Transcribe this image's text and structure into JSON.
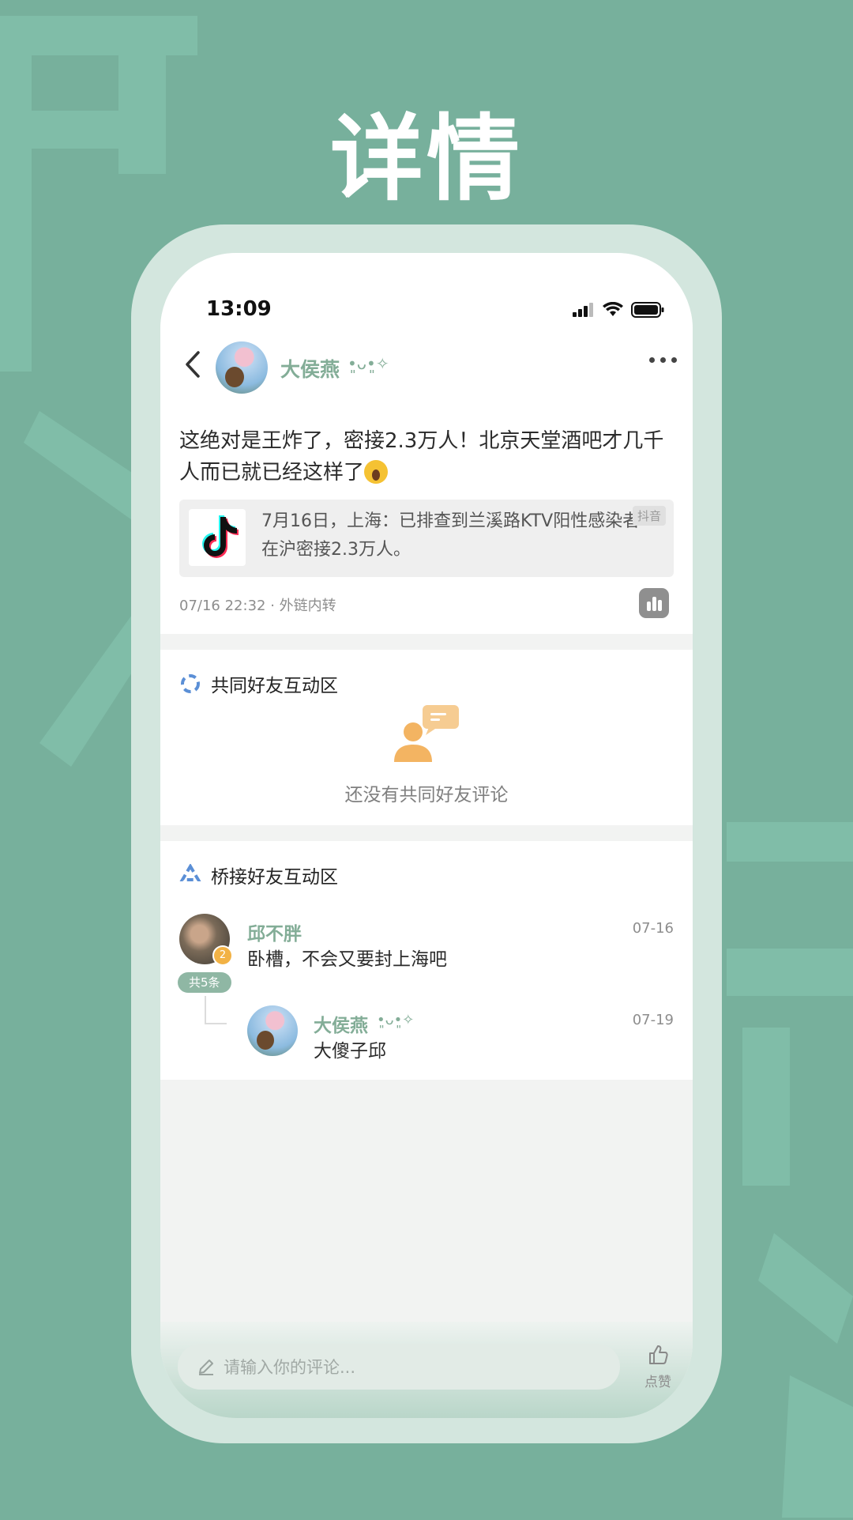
{
  "promo": {
    "title": "详情"
  },
  "status_bar": {
    "time": "13:09"
  },
  "header": {
    "user_name": "大侯燕",
    "name_deco": "•͈ᴗ•͈✧"
  },
  "post": {
    "text": "这绝对是王炸了，密接2.3万人！北京天堂酒吧才几千人而已就已经这样了",
    "emoji": "scream-emoji",
    "link_card": {
      "title": "7月16日，上海：已排查到兰溪路KTV阳性感染者在沪密接2.3万人。",
      "source_tag": "抖音",
      "icon": "tiktok-icon"
    },
    "meta": "07/16 22:32 · 外链内转"
  },
  "mutual_section": {
    "title": "共同好友互动区",
    "empty_text": "还没有共同好友评论"
  },
  "bridge_section": {
    "title": "桥接好友互动区",
    "comments": [
      {
        "name": "邱不胖",
        "badge": "2",
        "text": "卧槽，不会又要封上海吧",
        "date": "07-16"
      },
      {
        "name": "大侯燕",
        "name_deco": "•͈ᴗ•͈✧",
        "text": "大傻子邱",
        "date": "07-19"
      }
    ],
    "count_label": "共5条"
  },
  "bottom_bar": {
    "placeholder": "请输入你的评论...",
    "like_label": "点赞"
  },
  "colors": {
    "background": "#77b09c",
    "accent_green": "#83ad97",
    "badge_orange": "#f2b245"
  }
}
